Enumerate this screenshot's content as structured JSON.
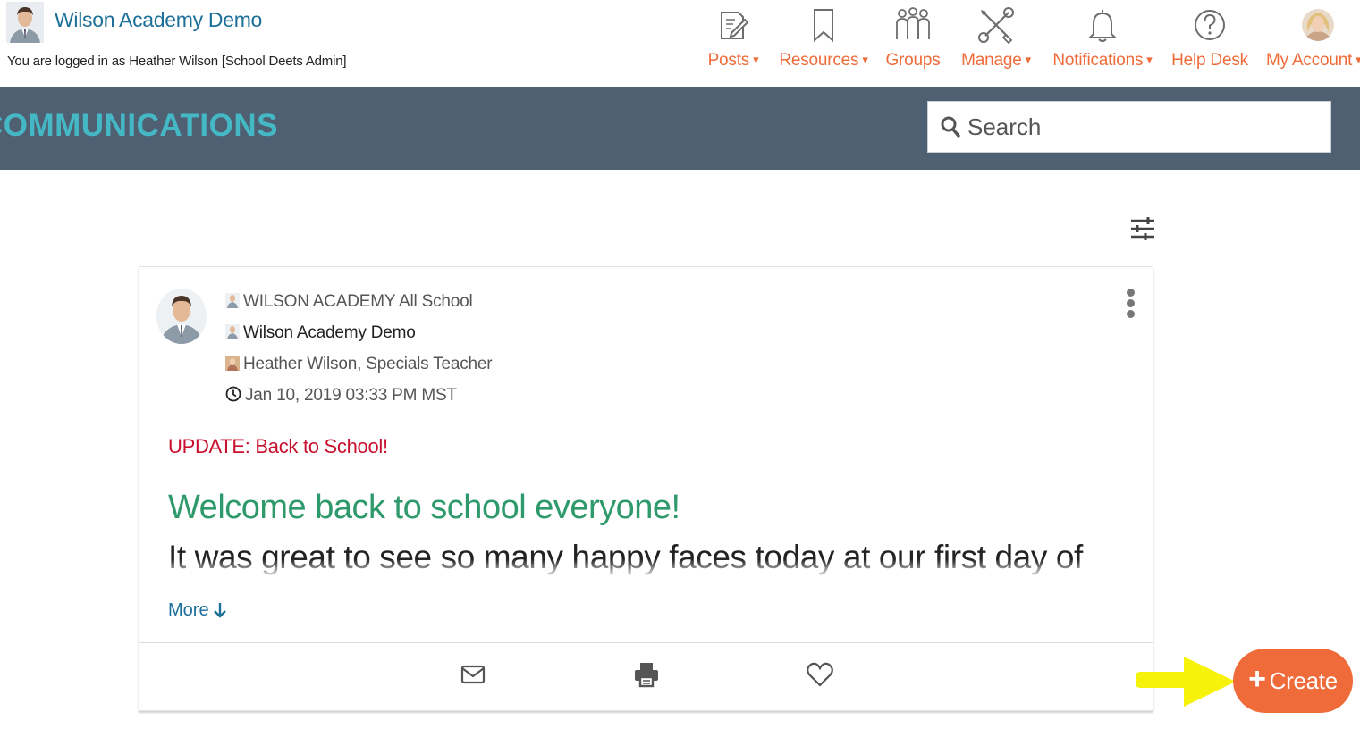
{
  "header": {
    "brand_title": "Wilson Academy Demo",
    "logged_in_text": "You are logged in as Heather Wilson [School Deets Admin]"
  },
  "nav": {
    "posts": {
      "label": "Posts",
      "caret": "▾",
      "icon": "edit-icon"
    },
    "resources": {
      "label": "Resources",
      "caret": "▾",
      "icon": "bookmark-icon"
    },
    "groups": {
      "label": "Groups",
      "icon": "people-icon"
    },
    "manage": {
      "label": "Manage",
      "caret": "▾",
      "icon": "tools-icon"
    },
    "notifications": {
      "label": "Notifications",
      "caret": "▾",
      "icon": "bell-icon"
    },
    "help_desk": {
      "label": "Help Desk",
      "icon": "help-icon"
    },
    "my_account": {
      "label": "My Account",
      "caret": "▾",
      "icon": "avatar"
    }
  },
  "section": {
    "title": "COMMUNICATIONS",
    "search_placeholder": "Search"
  },
  "post": {
    "audience": "WILSON ACADEMY All School",
    "school": "Wilson Academy Demo",
    "author": "Heather Wilson, Specials Teacher",
    "timestamp": "Jan 10, 2019 03:33 PM MST",
    "update_label": "UPDATE: Back to School!",
    "heading": "Welcome back to school everyone!",
    "body": "It was great to see so many happy faces today at our first day of",
    "more_label": "More"
  },
  "actions": {
    "create_label": "Create"
  },
  "colors": {
    "accent_orange": "#ef6b3a",
    "brand_blue": "#1b6f99",
    "section_bar": "#4f6073",
    "section_title": "#45b8c6",
    "update_red": "#c8102e",
    "heading_green": "#2e9a6c",
    "annotation_arrow": "#f7f20a"
  }
}
